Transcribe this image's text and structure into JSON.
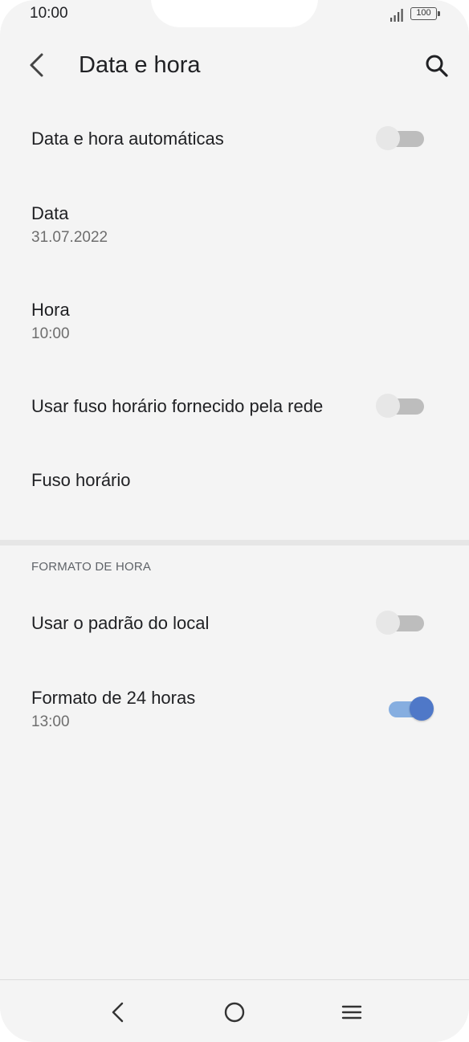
{
  "status_bar": {
    "time": "10:00",
    "battery": "100",
    "icons": [
      "signal-icon",
      "battery-icon"
    ]
  },
  "toolbar": {
    "title": "Data e hora",
    "back_icon": "back-arrow-icon",
    "search_icon": "search-icon"
  },
  "settings": {
    "auto_datetime": {
      "title": "Data e hora automáticas",
      "enabled": false
    },
    "date": {
      "title": "Data",
      "value": "31.07.2022"
    },
    "time": {
      "title": "Hora",
      "value": "10:00"
    },
    "network_timezone": {
      "title": "Usar fuso horário fornecido pela rede",
      "enabled": false
    },
    "timezone": {
      "title": "Fuso horário"
    }
  },
  "time_format": {
    "header": "FORMATO DE HORA",
    "locale_default": {
      "title": "Usar o padrão do local",
      "enabled": false
    },
    "format_24h": {
      "title": "Formato de 24 horas",
      "value": "13:00",
      "enabled": true
    }
  },
  "nav_bar": {
    "icons": [
      "nav-back-icon",
      "nav-home-icon",
      "nav-menu-icon"
    ]
  },
  "colors": {
    "background": "#f4f4f4",
    "switch_on_thumb": "#4f78c8",
    "switch_on_track": "#86aee0",
    "switch_off_thumb": "#e7e7e7",
    "switch_off_track": "#bdbdbd"
  }
}
